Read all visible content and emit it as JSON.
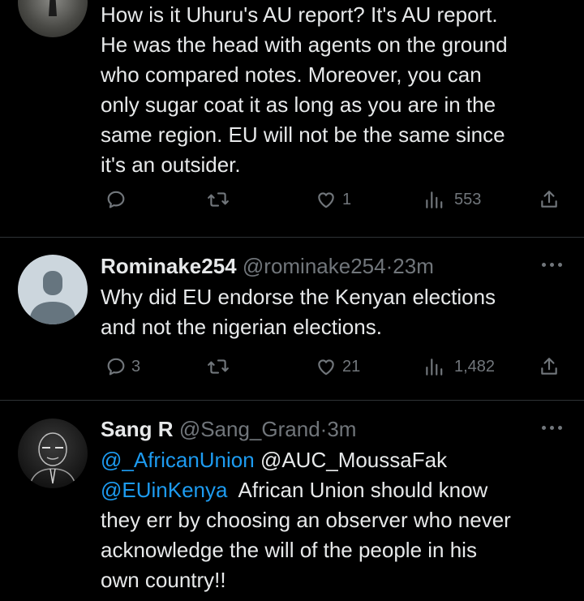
{
  "colors": {
    "background": "#000000",
    "text": "#e7e9ea",
    "muted": "#71767b",
    "link": "#1d9bf0",
    "divider": "#2f3336"
  },
  "tweets": [
    {
      "body": "How is it Uhuru's AU report? It's AU report. He was the head with agents on the ground who compared notes. Moreover, you can only sugar coat it as long as you are in the same region. EU will not be the same since it's an outsider.",
      "lines": [
        "How is it Uhuru's AU report? It's AU report.",
        "He was the head with agents on the ground",
        "who compared notes. Moreover, you can",
        "only sugar coat it as long as you are in the",
        "same region. EU will not be the same since",
        "it's an outsider."
      ],
      "replies": "",
      "retweets": "",
      "likes": "1",
      "views": "553"
    },
    {
      "name": "Rominake254",
      "handle": "@rominake254",
      "separator": "·",
      "time": "23m",
      "lines": [
        "Why did EU endorse the Kenyan elections",
        "and not the nigerian elections."
      ],
      "replies": "3",
      "retweets": "",
      "likes": "21",
      "views": "1,482"
    },
    {
      "name": "Sang R",
      "handle": "@Sang_Grand",
      "separator": "·",
      "time": "3m",
      "mention1": "@_AfricanUnion",
      "text1": " @AUC_MoussaFak",
      "mention2": "@EUinKenya",
      "text2": "  African Union should know",
      "lines": [
        "they err by choosing an observer who never",
        "acknowledge the will of the people in his",
        "own country!!"
      ]
    }
  ],
  "icons": [
    "reply-icon",
    "retweet-icon",
    "like-icon",
    "views-icon",
    "share-icon",
    "more-icon"
  ]
}
